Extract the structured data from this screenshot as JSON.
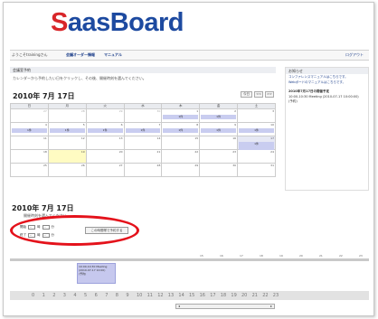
{
  "logo": {
    "first_letter": "S",
    "rest": "aasBoard"
  },
  "nav": {
    "user": "ようこそtrainingさん",
    "item1": "会議オーダー情報",
    "item2": "マニュアル",
    "logout": "ログアウト"
  },
  "reservation": {
    "section_title": "会議室予約",
    "instruction": "カレンダーから予約したい日をクリックし、その後、開催時刻を選んでください。",
    "month_title": "2010年 7月 17日",
    "view_buttons": [
      "今日",
      "<<",
      ">>"
    ]
  },
  "calendar": {
    "weekdays": [
      "日",
      "月",
      "火",
      "水",
      "木",
      "金",
      "土"
    ],
    "weeks": [
      [
        {
          "d": "27",
          "g": true
        },
        {
          "d": "28",
          "g": true
        },
        {
          "d": "29",
          "g": true
        },
        {
          "d": "30",
          "g": true
        },
        {
          "d": "1",
          "e": "1件"
        },
        {
          "d": "2",
          "e": "1件"
        },
        {
          "d": "3"
        }
      ],
      [
        {
          "d": "4",
          "e": "1件"
        },
        {
          "d": "5",
          "e": "1件"
        },
        {
          "d": "6",
          "e": "1件"
        },
        {
          "d": "7",
          "e": "1件"
        },
        {
          "d": "8",
          "e": "1件"
        },
        {
          "d": "9",
          "e": "1件"
        },
        {
          "d": "10",
          "e": "1件"
        }
      ],
      [
        {
          "d": "11"
        },
        {
          "d": "12"
        },
        {
          "d": "13"
        },
        {
          "d": "14"
        },
        {
          "d": "15"
        },
        {
          "d": "16"
        },
        {
          "d": "17",
          "e": "1件",
          "sel": true
        }
      ],
      [
        {
          "d": "18"
        },
        {
          "d": "19",
          "today": true
        },
        {
          "d": "20"
        },
        {
          "d": "21"
        },
        {
          "d": "22"
        },
        {
          "d": "23"
        },
        {
          "d": "24"
        }
      ],
      [
        {
          "d": "25"
        },
        {
          "d": "26"
        },
        {
          "d": "27"
        },
        {
          "d": "28"
        },
        {
          "d": "29"
        },
        {
          "d": "30"
        },
        {
          "d": "31"
        }
      ]
    ]
  },
  "sidebar": {
    "title": "お知らせ",
    "links": [
      "コンファレンスマニュアルはこちらです。",
      "Webボードのマニュアルはこちらです。"
    ],
    "subheading": "2010年7月17日の開催予定",
    "items": [
      "10:00-10:30 Meeting (2010-07-17 10:00:00)",
      "(予約)"
    ]
  },
  "day": {
    "title": "2010年 7月 17日",
    "subtitle": "開催時刻を選んでください。",
    "start_label": "開始",
    "end_label": "終了",
    "start_hour": "--",
    "start_min": "--",
    "end_hour": "--",
    "end_min": "--",
    "hour_unit": "時",
    "min_unit": "分",
    "submit_label": "この時間帯で予約する"
  },
  "timeline_labels": [
    "15",
    "16",
    "17",
    "18",
    "19",
    "20",
    "21",
    "22",
    "23"
  ],
  "event": {
    "line1": "10:00-10:30 Meeting",
    "line2": "(2010-07-17 10:00)",
    "line3": "(予約)"
  },
  "hours": [
    "0",
    "1",
    "2",
    "3",
    "4",
    "5",
    "6",
    "7",
    "8",
    "9",
    "10",
    "11",
    "12",
    "13",
    "14",
    "15",
    "16",
    "17",
    "18",
    "19",
    "20",
    "21",
    "22",
    "23"
  ]
}
